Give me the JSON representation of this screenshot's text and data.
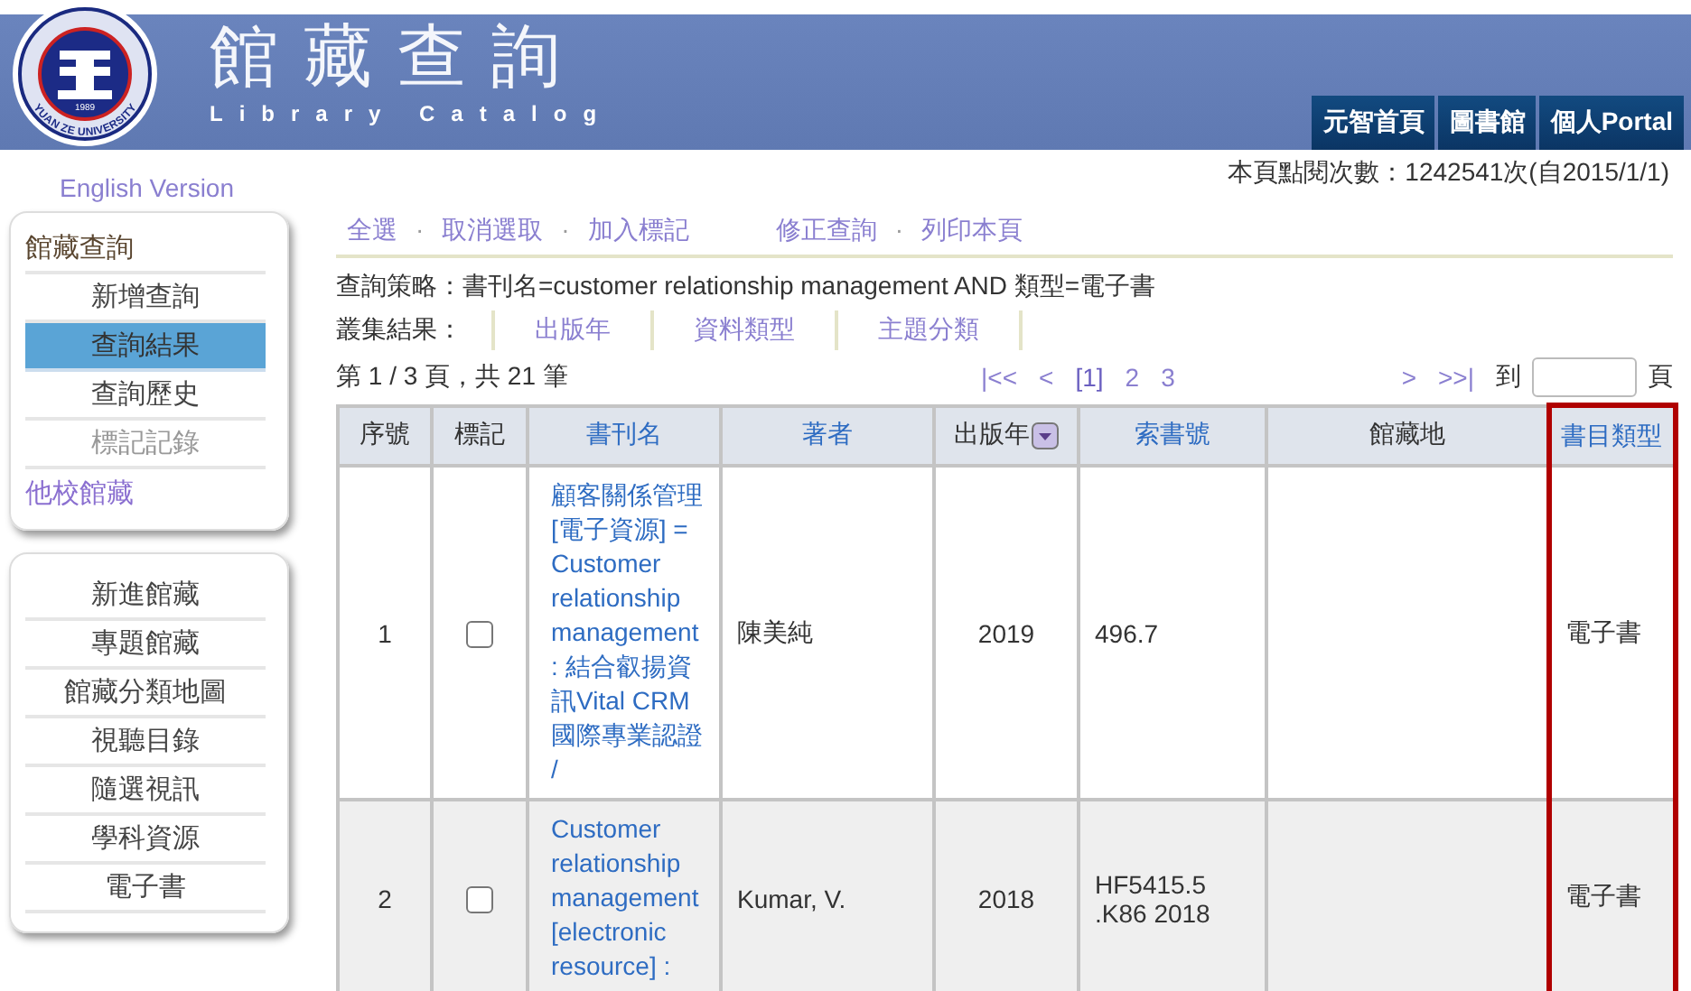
{
  "header": {
    "logo": {
      "year": "1989",
      "ring_text": "YUAN ZE UNIVERSITY"
    },
    "title": "館藏查詢",
    "subtitle": "Library Catalog",
    "nav": [
      "元智首頁",
      "圖書館",
      "個人Portal"
    ]
  },
  "top_bar": {
    "language_link": "English Version",
    "counter": "本頁點閱次數：1242541次(自2015/1/1)"
  },
  "sidebar": {
    "panels": [
      {
        "heading": "館藏查詢",
        "items": [
          {
            "label": "新增查詢",
            "selected": false,
            "disabled": false
          },
          {
            "label": "查詢結果",
            "selected": true,
            "disabled": false
          },
          {
            "label": "查詢歷史",
            "selected": false,
            "disabled": false
          },
          {
            "label": "標記記錄",
            "selected": false,
            "disabled": true
          }
        ],
        "footer_link": "他校館藏"
      },
      {
        "items": [
          {
            "label": "新進館藏",
            "selected": false,
            "disabled": false
          },
          {
            "label": "專題館藏",
            "selected": false,
            "disabled": false
          },
          {
            "label": "館藏分類地圖",
            "selected": false,
            "disabled": false
          },
          {
            "label": "視聽目錄",
            "selected": false,
            "disabled": false
          },
          {
            "label": "隨選視訊",
            "selected": false,
            "disabled": false
          },
          {
            "label": "學科資源",
            "selected": false,
            "disabled": false
          },
          {
            "label": "電子書",
            "selected": false,
            "disabled": false
          }
        ]
      }
    ]
  },
  "actions": {
    "separator": "·",
    "groups": [
      [
        "全選",
        "取消選取",
        "加入標記"
      ],
      [
        "修正查詢",
        "列印本頁"
      ]
    ]
  },
  "strategy": "查詢策略：書刊名=customer relationship management AND 類型=電子書",
  "facets": {
    "label": "叢集結果：",
    "items": [
      "出版年",
      "資料類型",
      "主題分類"
    ]
  },
  "pagination": {
    "summary": "第 1 / 3 頁，共 21 筆",
    "pages": [
      {
        "label": "|<<",
        "selected": false
      },
      {
        "label": "<",
        "selected": false
      },
      {
        "label": "[1]",
        "selected": true
      },
      {
        "label": "2",
        "selected": false
      },
      {
        "label": "3",
        "selected": false
      }
    ],
    "next": [
      ">",
      ">>|"
    ],
    "goto_label": "到",
    "goto_suffix": "頁"
  },
  "table": {
    "columns": [
      {
        "label": "序號",
        "link": false,
        "sort_menu": false,
        "highlighted": false
      },
      {
        "label": "標記",
        "link": false,
        "sort_menu": false,
        "highlighted": false
      },
      {
        "label": "書刊名",
        "link": true,
        "sort_menu": false,
        "highlighted": false
      },
      {
        "label": "著者",
        "link": true,
        "sort_menu": false,
        "highlighted": false
      },
      {
        "label": "出版年",
        "link": false,
        "sort_menu": true,
        "highlighted": false
      },
      {
        "label": "索書號",
        "link": true,
        "sort_menu": false,
        "highlighted": false
      },
      {
        "label": "館藏地",
        "link": false,
        "sort_menu": false,
        "highlighted": false
      },
      {
        "label": "書目類型",
        "link": true,
        "sort_menu": false,
        "highlighted": true
      }
    ],
    "rows": [
      {
        "number": "1",
        "checked": false,
        "title": "顧客關係管理[電子資源] = Customer relationship management : 結合叡揚資訊Vital CRM國際專業認證 /",
        "author": "陳美純",
        "year": "2019",
        "call_number": "496.7",
        "location": "",
        "type": "電子書"
      },
      {
        "number": "2",
        "checked": false,
        "title": "Customer relationship management [electronic resource] :",
        "author": "Kumar, V.",
        "year": "2018",
        "call_number": "HF5415.5 .K86 2018",
        "location": "",
        "type": "電子書"
      }
    ]
  }
}
